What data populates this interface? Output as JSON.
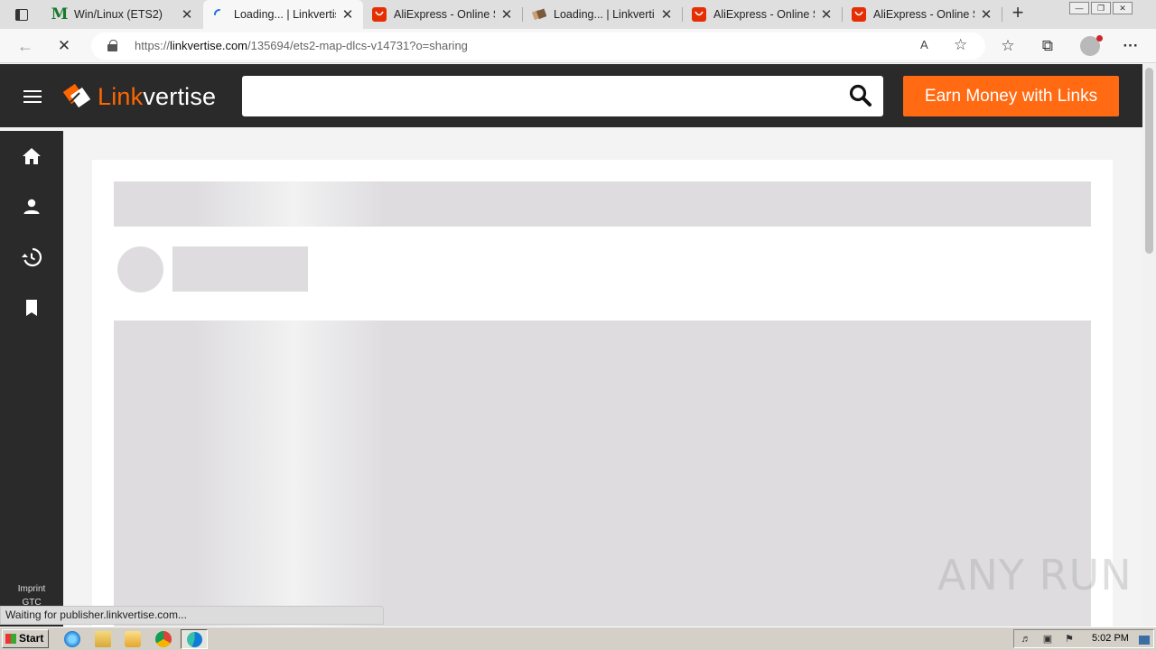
{
  "browser": {
    "tabs": [
      {
        "title": "Win/Linux (ETS2)",
        "favicon": "m-favicon",
        "active": false
      },
      {
        "title": "Loading... | Linkvertise",
        "favicon": "loading-spinner-icon",
        "active": true
      },
      {
        "title": "AliExpress - Online Shopping",
        "favicon": "aliexpress-icon",
        "active": false
      },
      {
        "title": "Loading... | Linkvertise",
        "favicon": "linkvertise-icon",
        "active": false
      },
      {
        "title": "AliExpress - Online Shopping",
        "favicon": "aliexpress-icon",
        "active": false
      },
      {
        "title": "AliExpress - Online Shopping",
        "favicon": "aliexpress-icon",
        "active": false
      }
    ],
    "tab_close_glyph": "✕",
    "new_tab_glyph": "+",
    "url_prefix": "https://",
    "url_domain": "linkvertise.com",
    "url_path": "/135694/ets2-map-dlcs-v14731?o=sharing",
    "read_aloud_label": "A",
    "status_text": "Waiting for publisher.linkvertise.com..."
  },
  "site": {
    "brand_link": "Link",
    "brand_vertise": "vertise",
    "search_placeholder": "",
    "earn_button": "Earn Money with Links",
    "sidenav": [
      "home-icon",
      "user-icon",
      "history-icon",
      "bookmark-icon"
    ],
    "footer_links": [
      "Imprint",
      "GTC"
    ]
  },
  "watermark": "ANY RUN",
  "taskbar": {
    "start_label": "Start",
    "clock": "5:02 PM"
  },
  "colors": {
    "accent": "#ff6a13",
    "header_bg": "#2a2a2a",
    "skeleton": "#dedcdf"
  }
}
